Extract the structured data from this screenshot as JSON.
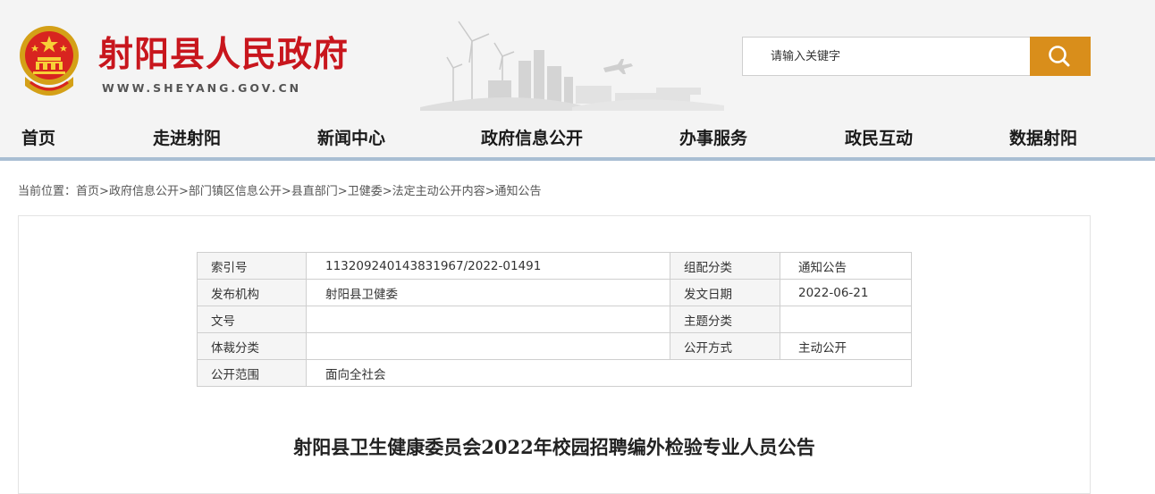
{
  "header": {
    "site_title": "射阳县人民政府",
    "site_url": "WWW.SHEYANG.GOV.CN"
  },
  "search": {
    "placeholder": "请输入关键字",
    "button_color": "#d98e1b"
  },
  "nav": {
    "items": [
      "首页",
      "走进射阳",
      "新闻中心",
      "政府信息公开",
      "办事服务",
      "政民互动",
      "数据射阳"
    ]
  },
  "breadcrumb": {
    "label": "当前位置：",
    "items": [
      "首页",
      "政府信息公开",
      "部门镇区信息公开",
      "县直部门",
      "卫健委",
      "法定主动公开内容",
      "通知公告"
    ],
    "separator": ">"
  },
  "meta_table": {
    "rows": [
      {
        "k1": "索引号",
        "v1": "113209240143831967/2022-01491",
        "k2": "组配分类",
        "v2": "通知公告"
      },
      {
        "k1": "发布机构",
        "v1": "射阳县卫健委",
        "k2": "发文日期",
        "v2": "2022-06-21"
      },
      {
        "k1": "文号",
        "v1": "",
        "k2": "主题分类",
        "v2": ""
      },
      {
        "k1": "体裁分类",
        "v1": "",
        "k2": "公开方式",
        "v2": "主动公开"
      },
      {
        "k1": "公开范围",
        "v1": "面向全社会"
      }
    ]
  },
  "document": {
    "title": "射阳县卫生健康委员会2022年校园招聘编外检验专业人员公告"
  },
  "colors": {
    "brand_red": "#c8161d",
    "accent_orange": "#d98e1b",
    "nav_rule": "#a9bed3"
  }
}
